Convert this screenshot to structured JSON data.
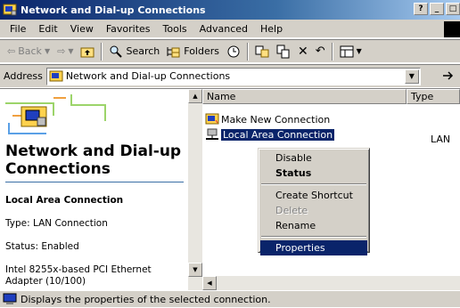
{
  "window": {
    "title": "Network and Dial-up Connections"
  },
  "menu": [
    "File",
    "Edit",
    "View",
    "Favorites",
    "Tools",
    "Advanced",
    "Help"
  ],
  "toolbar": {
    "back_label": "Back",
    "search_label": "Search",
    "folders_label": "Folders"
  },
  "address": {
    "label": "Address",
    "value": "Network and Dial-up Connections"
  },
  "left_pane": {
    "title": "Network and Dial-up Connections",
    "selected_name": "Local Area Connection",
    "type_text": "Type: LAN Connection",
    "status_text": "Status: Enabled",
    "adapter_text": "Intel 8255x-based PCI Ethernet Adapter (10/100)"
  },
  "list": {
    "columns": [
      "Name",
      "Type"
    ],
    "rows": [
      {
        "name": "Make New Connection",
        "type": ""
      },
      {
        "name": "Local Area Connection",
        "type": "LAN"
      }
    ]
  },
  "context_menu": [
    {
      "label": "Disable",
      "style": "normal"
    },
    {
      "label": "Status",
      "style": "bold"
    },
    {
      "label": "Create Shortcut",
      "style": "normal"
    },
    {
      "label": "Delete",
      "style": "disabled"
    },
    {
      "label": "Rename",
      "style": "normal"
    },
    {
      "label": "Properties",
      "style": "highlight"
    }
  ],
  "status_bar": {
    "text": "Displays the properties of the selected connection."
  },
  "colors": {
    "selection": "#0a246a",
    "face": "#d4d0c8",
    "title_start": "#0a246a",
    "title_end": "#a6caf0"
  }
}
